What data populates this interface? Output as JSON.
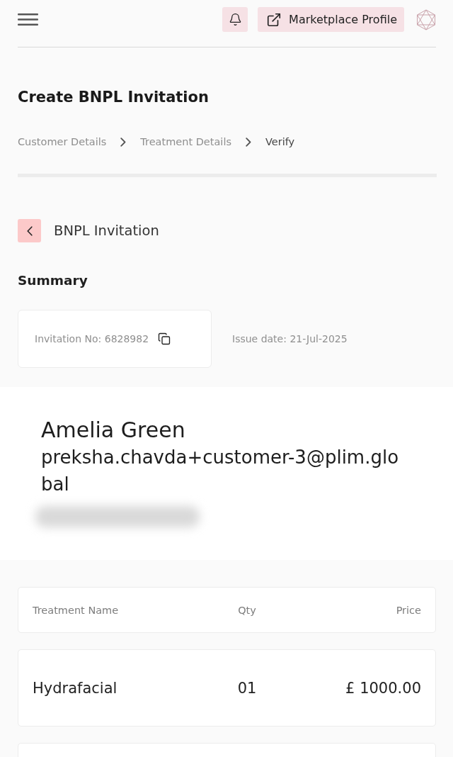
{
  "header": {
    "profile_button": "Marketplace Profile"
  },
  "page_title": "Create BNPL Invitation",
  "breadcrumb": [
    {
      "label": "Customer Details",
      "selected": false
    },
    {
      "label": "Treatment Details",
      "selected": false
    },
    {
      "label": "Verify",
      "selected": true
    }
  ],
  "section_title": "BNPL Invitation",
  "summary": {
    "heading": "Summary",
    "invitation_no": "Invitation No: 6828982",
    "issue_date": "Issue date: 21-Jul-2025"
  },
  "customer": {
    "name": "Amelia Green",
    "email": "preksha.chavda+customer-3@plim.global"
  },
  "table": {
    "columns": [
      "Treatment Name",
      "Qty",
      "Price"
    ],
    "rows": [
      {
        "treatment_name": "Hydrafacial",
        "qty": "01",
        "price": "£ 1000.00"
      }
    ]
  }
}
